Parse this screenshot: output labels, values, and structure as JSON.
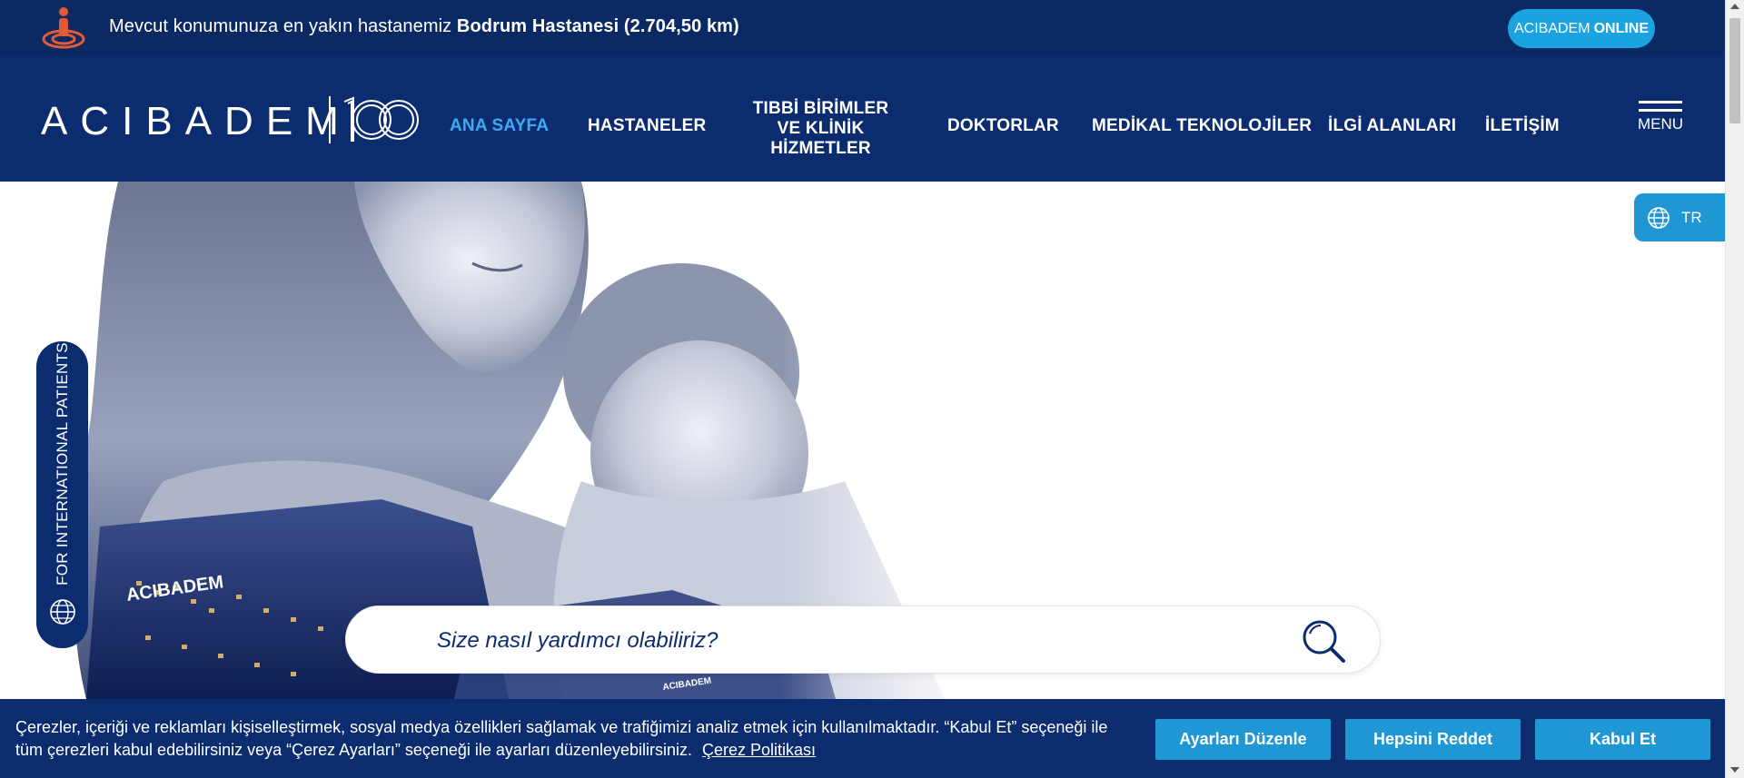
{
  "topbar": {
    "location_text_prefix": "Mevcut konumunuza en yakın hastanemiz",
    "location_text_hospital": "Bodrum Hastanesi (2.704,50 km)",
    "online_label_prefix": "ACIBADEM",
    "online_label_suffix": "ONLINE"
  },
  "navbar": {
    "logo_text": "ACIBADEM",
    "logo_badge": "100",
    "items": [
      {
        "label": "ANA SAYFA",
        "active": true
      },
      {
        "label": "HASTANELER"
      },
      {
        "label_line1": "TIBBİ BİRİMLER",
        "label_line2": "VE KLİNİK HİZMETLER"
      },
      {
        "label": "DOKTORLAR"
      },
      {
        "label": "MEDİKAL TEKNOLOJİLER"
      },
      {
        "label": "İLGİ ALANLARI"
      },
      {
        "label": "İLETİŞİM"
      }
    ],
    "menu_label": "MENU"
  },
  "lang": {
    "label": "TR"
  },
  "international": {
    "label": "FOR INTERNATIONAL PATIENTS"
  },
  "hero": {
    "building_sign": "ACIBADEM",
    "building_sign_small": "ACIBADEM"
  },
  "search": {
    "placeholder": "Size nasıl yardımcı olabiliriz?"
  },
  "cookie": {
    "text": "Çerezler, içeriği ve reklamları kişiselleştirmek, sosyal medya özellikleri sağlamak ve trafiğimizi analiz etmek için kullanılmaktadır. “Kabul Et” seçeneği ile tüm çerezleri kabul edebilirsiniz veya “Çerez Ayarları” seçeneği ile ayarları düzenleyebilirsiniz.",
    "policy_link": "Çerez Politikası",
    "buttons": {
      "settings": "Ayarları Düzenle",
      "reject": "Hepsini Reddet",
      "accept": "Kabul Et"
    }
  },
  "colors": {
    "navy": "#0c2c70",
    "topbar": "#0b2a63",
    "accent": "#1f97d4",
    "active": "#3fa9f5",
    "online": "#1aa3e0"
  }
}
